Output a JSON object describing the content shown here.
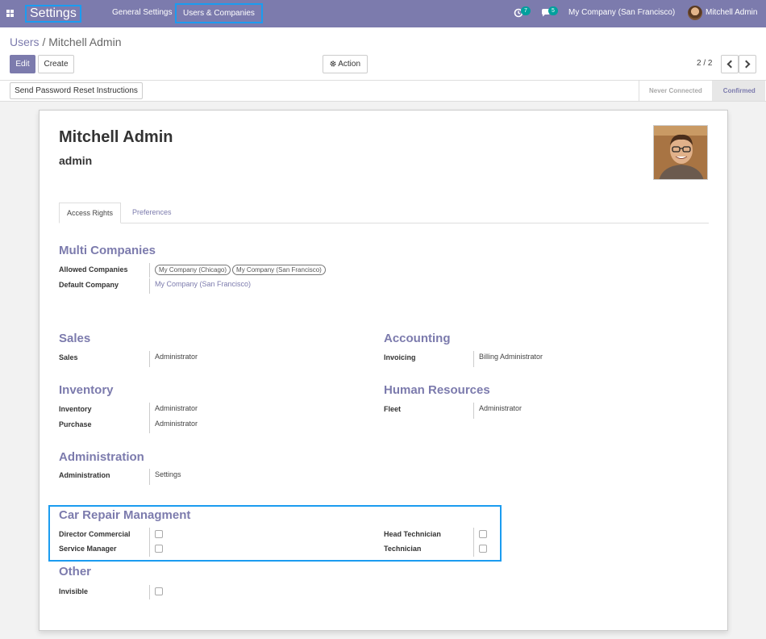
{
  "navbar": {
    "app_title": "Settings",
    "menu": [
      "General Settings",
      "Users & Companies"
    ],
    "activity_count": "7",
    "messages_count": "5",
    "company": "My Company (San Francisco)",
    "user": "Mitchell Admin"
  },
  "breadcrumb": {
    "parent": "Users",
    "separator": "/",
    "current": "Mitchell Admin"
  },
  "buttons": {
    "edit": "Edit",
    "create": "Create",
    "action": "Action",
    "send_reset": "Send Password Reset Instructions"
  },
  "pager": {
    "text": "2 / 2"
  },
  "status": {
    "steps": [
      "Never Connected",
      "Confirmed"
    ],
    "active": "Confirmed"
  },
  "user": {
    "name": "Mitchell Admin",
    "login": "admin"
  },
  "tabs": [
    "Access Rights",
    "Preferences"
  ],
  "multi_companies": {
    "title": "Multi Companies",
    "allowed_label": "Allowed Companies",
    "allowed": [
      "My Company (Chicago)",
      "My Company (San Francisco)"
    ],
    "default_label": "Default Company",
    "default": "My Company (San Francisco)"
  },
  "sales": {
    "title": "Sales",
    "label": "Sales",
    "value": "Administrator"
  },
  "accounting": {
    "title": "Accounting",
    "label": "Invoicing",
    "value": "Billing Administrator"
  },
  "inventory": {
    "title": "Inventory",
    "inventory_label": "Inventory",
    "inventory_value": "Administrator",
    "purchase_label": "Purchase",
    "purchase_value": "Administrator"
  },
  "hr": {
    "title": "Human Resources",
    "label": "Fleet",
    "value": "Administrator"
  },
  "administration": {
    "title": "Administration",
    "label": "Administration",
    "value": "Settings"
  },
  "car_repair": {
    "title": "Car Repair Managment",
    "director": "Director Commercial",
    "service_manager": "Service Manager",
    "head_technician": "Head Technician",
    "technician": "Technician"
  },
  "other": {
    "title": "Other",
    "invisible": "Invisible"
  }
}
